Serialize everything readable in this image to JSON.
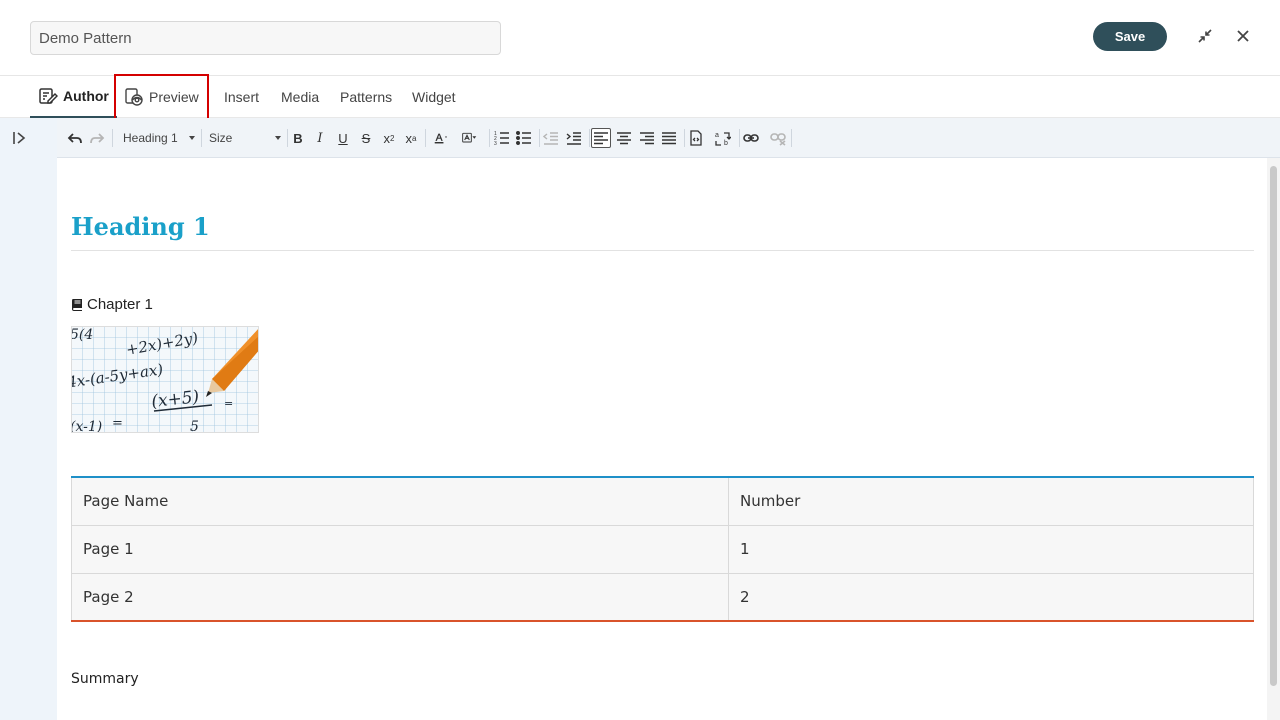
{
  "header": {
    "title_value": "Demo Pattern",
    "save_label": "Save"
  },
  "tabs": [
    {
      "label": "Author",
      "icon": "author-edit-icon"
    },
    {
      "label": "Preview",
      "icon": "preview-eye-icon"
    },
    {
      "label": "Insert"
    },
    {
      "label": "Media"
    },
    {
      "label": "Patterns"
    },
    {
      "label": "Widget"
    }
  ],
  "toolbar": {
    "format_value": "Heading 1",
    "size_value": "Size"
  },
  "content": {
    "heading": "Heading 1",
    "chapter": "Chapter 1",
    "table": {
      "headers": [
        "Page Name",
        "Number"
      ],
      "rows": [
        [
          "Page 1",
          "1"
        ],
        [
          "Page 2",
          "2"
        ]
      ]
    },
    "summary": "Summary"
  },
  "colors": {
    "accent": "#1aa0c9",
    "save_button": "#2f4f5a",
    "table_top_border": "#1e90c8",
    "table_bottom_border": "#d9532b",
    "highlight": "#d40000"
  }
}
